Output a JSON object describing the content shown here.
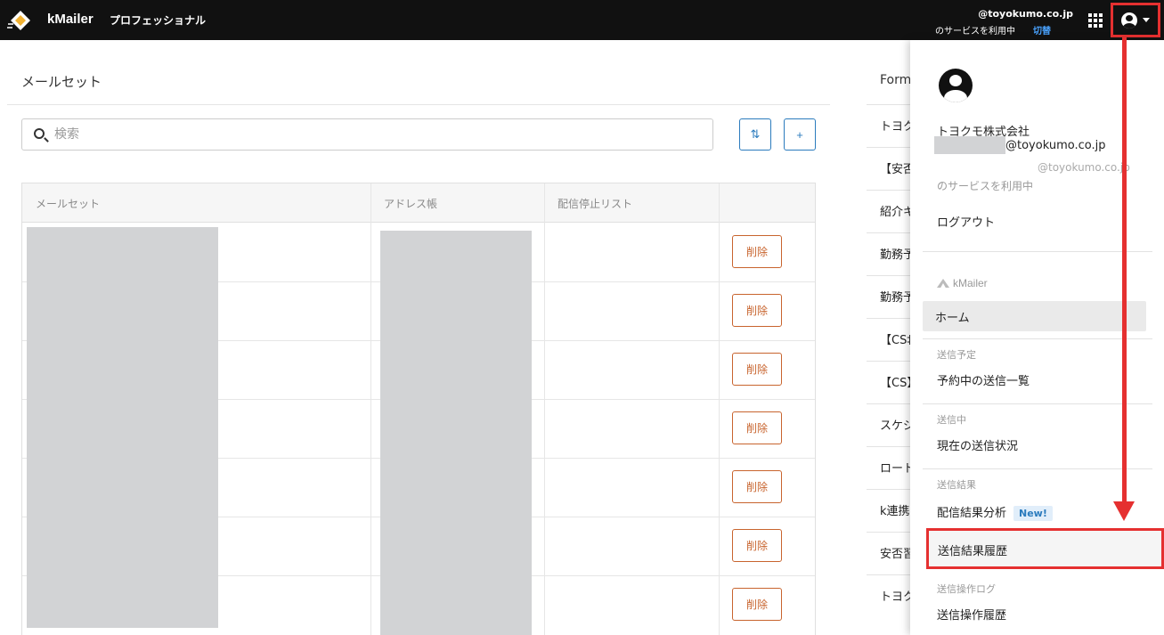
{
  "header": {
    "app_name": "kMailer",
    "plan": "プロフェッショナル",
    "account_email": "@toyokumo.co.jp",
    "service_text": "のサービスを利用中",
    "switch_link": "切替"
  },
  "main": {
    "title": "メールセット",
    "search": {
      "placeholder": "検索"
    },
    "sort_button": "⇅",
    "add_button": "+",
    "table": {
      "columns": [
        "メールセット",
        "アドレス帳",
        "配信停止リスト",
        ""
      ],
      "delete_label": "削除",
      "row_count": 7
    }
  },
  "form_column": {
    "header": "Form",
    "items": [
      "トヨク",
      "【安否",
      "紹介キ",
      "勤務予",
      "勤務予",
      "【CS‡",
      "【CS】",
      "スケジ",
      "ロート",
      "k連携",
      "安否習",
      "トヨク"
    ]
  },
  "dropdown": {
    "company": "トヨクモ株式会社",
    "email": "@toyokumo.co.jp",
    "service_email": "@toyokumo.co.jp",
    "service_text": "のサービスを利用中",
    "logout": "ログアウト",
    "brand": "kMailer",
    "home": "ホーム",
    "sections": [
      {
        "category": "送信予定",
        "link": "予約中の送信一覧"
      },
      {
        "category": "送信中",
        "link": "現在の送信状況"
      },
      {
        "category": "送信結果",
        "link": "配信結果分析",
        "badge": "New!"
      },
      {
        "category": "",
        "link": "送信結果履歴"
      },
      {
        "category": "送信操作ログ",
        "link": "送信操作履歴"
      }
    ]
  },
  "colors": {
    "accent": "#2b7bbd",
    "delete": "#c8642e",
    "annotation": "#e53030"
  }
}
